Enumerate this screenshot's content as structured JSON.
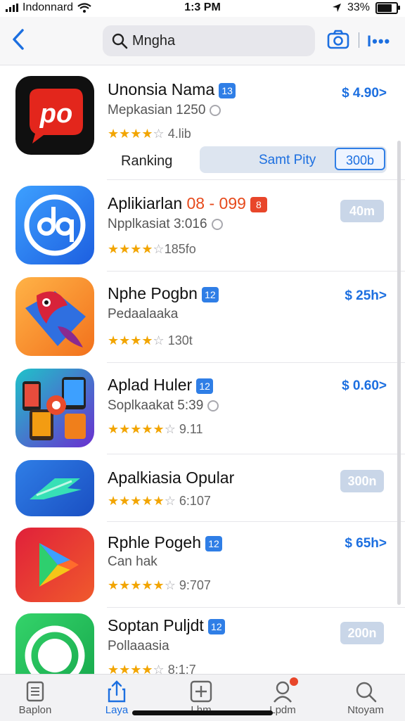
{
  "status": {
    "carrier": "Indonnard",
    "time": "1:3 PM",
    "battery": "33%"
  },
  "search": {
    "value": "Mngha"
  },
  "apps": [
    {
      "title": "Unonsia Nama",
      "badge": "13",
      "subtitle": "Mepkasian 1250",
      "rating_text": "4.lib",
      "stars": 4,
      "price": "$ 4.90>"
    },
    {
      "title_prefix": "Aplikiarlan",
      "title_highlight": "08 - 099",
      "badge": "8",
      "subtitle": "Npplkasiat 3:016",
      "rating_text": "185fo",
      "stars": 4,
      "pill": "40m"
    },
    {
      "title": "Nphe Pogbn",
      "badge": "12",
      "subtitle": "Pedaalaaka",
      "rating_text": "130t",
      "stars": 4,
      "price": "$ 25h>"
    },
    {
      "title": "Aplad Huler",
      "badge": "12",
      "subtitle": "Soplkaakat 5:39",
      "rating_text": "9.11",
      "stars": 5,
      "price": "$ 0.60>"
    },
    {
      "title": "Apalkiasia Opular",
      "rating_text": "6:107",
      "stars": 5,
      "pill": "300n"
    },
    {
      "title": "Rphle Pogeh",
      "badge": "12",
      "subtitle": "Can hak",
      "rating_text": "9:707",
      "stars": 5,
      "price": "$ 65h>"
    },
    {
      "title": "Soptan Puljdt",
      "badge": "12",
      "subtitle": "Pollaaasia",
      "rating_text": "8:1:7",
      "stars": 4,
      "pill": "200n"
    }
  ],
  "ranking": {
    "label": "Ranking",
    "option": "Samt Pity",
    "value": "300b"
  },
  "tabs": [
    {
      "label": "Baplon",
      "icon": "document-icon"
    },
    {
      "label": "Laya",
      "icon": "share-icon"
    },
    {
      "label": "Lhm",
      "icon": "plus-square-icon"
    },
    {
      "label": "Lpdm",
      "icon": "person-icon"
    },
    {
      "label": "Ntoyam",
      "icon": "search-icon"
    }
  ],
  "colors": {
    "accent": "#1c6fe0",
    "star": "#f2a500",
    "highlight": "#e64a1c",
    "pill": "#c9d6e8"
  }
}
